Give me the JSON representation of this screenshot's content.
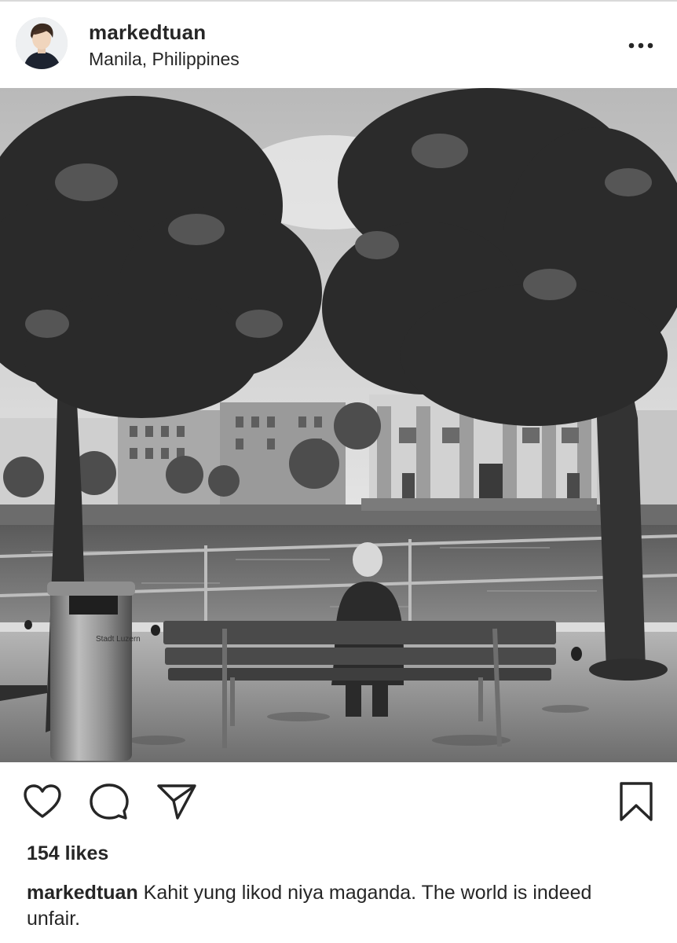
{
  "post": {
    "username": "markedtuan",
    "location": "Manila, Philippines",
    "likes": "154 likes",
    "caption_user": "markedtuan",
    "caption_text": "Kahit yung likod niya maganda. The world is indeed unfair."
  },
  "photo": {
    "sign_text": "Stadt Luzern"
  },
  "icons": {
    "more": "more-options-icon",
    "like": "heart-icon",
    "comment": "comment-bubble-icon",
    "share": "paper-plane-icon",
    "save": "bookmark-icon"
  },
  "colors": {
    "text": "#262626",
    "divider": "#d9d9d9"
  }
}
